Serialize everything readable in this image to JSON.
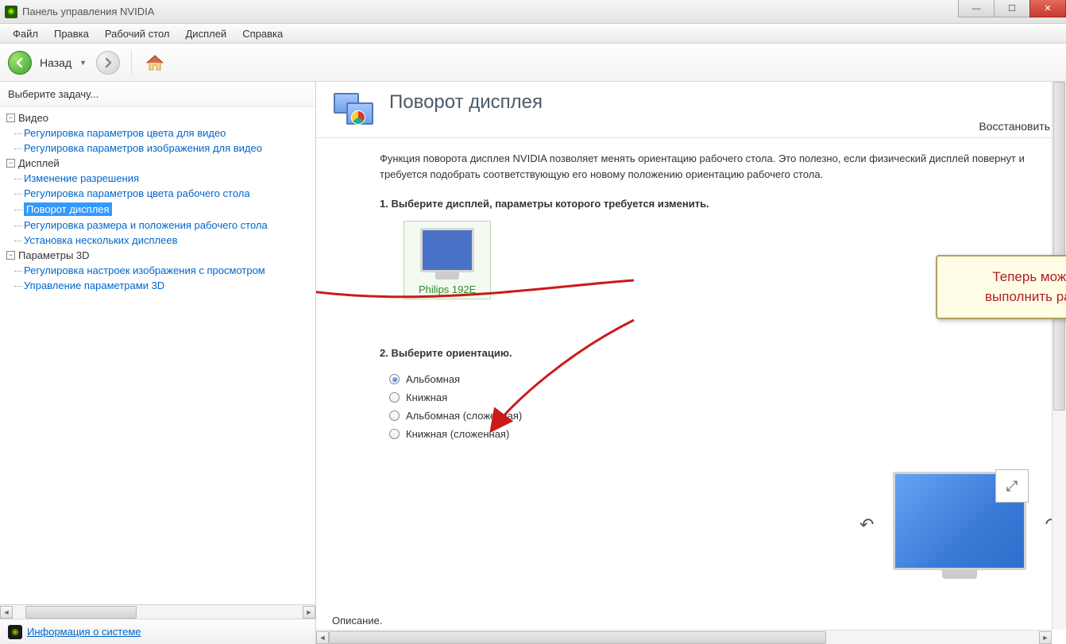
{
  "window": {
    "title": "Панель управления NVIDIA"
  },
  "menu": {
    "items": [
      "Файл",
      "Правка",
      "Рабочий стол",
      "Дисплей",
      "Справка"
    ]
  },
  "toolbar": {
    "back": "Назад"
  },
  "sidebar": {
    "header": "Выберите задачу...",
    "groups": [
      {
        "label": "Видео",
        "items": [
          "Регулировка параметров цвета для видео",
          "Регулировка параметров изображения для видео"
        ]
      },
      {
        "label": "Дисплей",
        "items": [
          "Изменение разрешения",
          "Регулировка параметров цвета рабочего стола",
          "Поворот дисплея",
          "Регулировка размера и положения рабочего стола",
          "Установка нескольких дисплеев"
        ],
        "selected": 2
      },
      {
        "label": "Параметры 3D",
        "items": [
          "Регулировка настроек изображения с просмотром",
          "Управление параметрами 3D"
        ]
      }
    ],
    "footer_link": "Информация о системе"
  },
  "main": {
    "title": "Поворот дисплея",
    "restore": "Восстановить",
    "description": "Функция поворота дисплея NVIDIA позволяет менять ориентацию рабочего стола. Это полезно, если физический дисплей повернут и требуется подобрать соответствующую его новому положению ориентацию рабочего стола.",
    "section1": "1. Выберите дисплей, параметры которого требуется изменить.",
    "display_name": "Philips 192E",
    "section2": "2. Выберите ориентацию.",
    "orientations": [
      "Альбомная",
      "Книжная",
      "Альбомная (сложенная)",
      "Книжная (сложенная)"
    ],
    "orientation_selected": 0,
    "footer_label": "Описание."
  },
  "callout": {
    "line1": "Теперь можете с легкостью",
    "line2": "выполнить разворот десплея!"
  }
}
